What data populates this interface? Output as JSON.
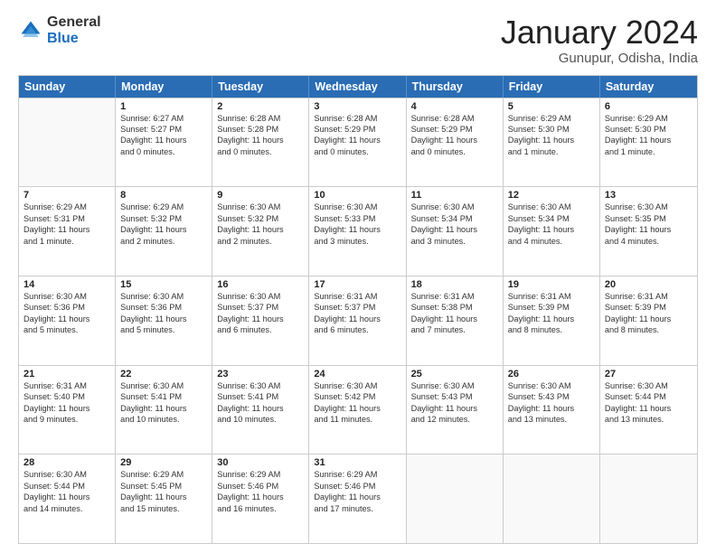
{
  "logo": {
    "general": "General",
    "blue": "Blue"
  },
  "title": "January 2024",
  "location": "Gunupur, Odisha, India",
  "header_days": [
    "Sunday",
    "Monday",
    "Tuesday",
    "Wednesday",
    "Thursday",
    "Friday",
    "Saturday"
  ],
  "weeks": [
    [
      {
        "day": "",
        "lines": []
      },
      {
        "day": "1",
        "lines": [
          "Sunrise: 6:27 AM",
          "Sunset: 5:27 PM",
          "Daylight: 11 hours",
          "and 0 minutes."
        ]
      },
      {
        "day": "2",
        "lines": [
          "Sunrise: 6:28 AM",
          "Sunset: 5:28 PM",
          "Daylight: 11 hours",
          "and 0 minutes."
        ]
      },
      {
        "day": "3",
        "lines": [
          "Sunrise: 6:28 AM",
          "Sunset: 5:29 PM",
          "Daylight: 11 hours",
          "and 0 minutes."
        ]
      },
      {
        "day": "4",
        "lines": [
          "Sunrise: 6:28 AM",
          "Sunset: 5:29 PM",
          "Daylight: 11 hours",
          "and 0 minutes."
        ]
      },
      {
        "day": "5",
        "lines": [
          "Sunrise: 6:29 AM",
          "Sunset: 5:30 PM",
          "Daylight: 11 hours",
          "and 1 minute."
        ]
      },
      {
        "day": "6",
        "lines": [
          "Sunrise: 6:29 AM",
          "Sunset: 5:30 PM",
          "Daylight: 11 hours",
          "and 1 minute."
        ]
      }
    ],
    [
      {
        "day": "7",
        "lines": [
          "Sunrise: 6:29 AM",
          "Sunset: 5:31 PM",
          "Daylight: 11 hours",
          "and 1 minute."
        ]
      },
      {
        "day": "8",
        "lines": [
          "Sunrise: 6:29 AM",
          "Sunset: 5:32 PM",
          "Daylight: 11 hours",
          "and 2 minutes."
        ]
      },
      {
        "day": "9",
        "lines": [
          "Sunrise: 6:30 AM",
          "Sunset: 5:32 PM",
          "Daylight: 11 hours",
          "and 2 minutes."
        ]
      },
      {
        "day": "10",
        "lines": [
          "Sunrise: 6:30 AM",
          "Sunset: 5:33 PM",
          "Daylight: 11 hours",
          "and 3 minutes."
        ]
      },
      {
        "day": "11",
        "lines": [
          "Sunrise: 6:30 AM",
          "Sunset: 5:34 PM",
          "Daylight: 11 hours",
          "and 3 minutes."
        ]
      },
      {
        "day": "12",
        "lines": [
          "Sunrise: 6:30 AM",
          "Sunset: 5:34 PM",
          "Daylight: 11 hours",
          "and 4 minutes."
        ]
      },
      {
        "day": "13",
        "lines": [
          "Sunrise: 6:30 AM",
          "Sunset: 5:35 PM",
          "Daylight: 11 hours",
          "and 4 minutes."
        ]
      }
    ],
    [
      {
        "day": "14",
        "lines": [
          "Sunrise: 6:30 AM",
          "Sunset: 5:36 PM",
          "Daylight: 11 hours",
          "and 5 minutes."
        ]
      },
      {
        "day": "15",
        "lines": [
          "Sunrise: 6:30 AM",
          "Sunset: 5:36 PM",
          "Daylight: 11 hours",
          "and 5 minutes."
        ]
      },
      {
        "day": "16",
        "lines": [
          "Sunrise: 6:30 AM",
          "Sunset: 5:37 PM",
          "Daylight: 11 hours",
          "and 6 minutes."
        ]
      },
      {
        "day": "17",
        "lines": [
          "Sunrise: 6:31 AM",
          "Sunset: 5:37 PM",
          "Daylight: 11 hours",
          "and 6 minutes."
        ]
      },
      {
        "day": "18",
        "lines": [
          "Sunrise: 6:31 AM",
          "Sunset: 5:38 PM",
          "Daylight: 11 hours",
          "and 7 minutes."
        ]
      },
      {
        "day": "19",
        "lines": [
          "Sunrise: 6:31 AM",
          "Sunset: 5:39 PM",
          "Daylight: 11 hours",
          "and 8 minutes."
        ]
      },
      {
        "day": "20",
        "lines": [
          "Sunrise: 6:31 AM",
          "Sunset: 5:39 PM",
          "Daylight: 11 hours",
          "and 8 minutes."
        ]
      }
    ],
    [
      {
        "day": "21",
        "lines": [
          "Sunrise: 6:31 AM",
          "Sunset: 5:40 PM",
          "Daylight: 11 hours",
          "and 9 minutes."
        ]
      },
      {
        "day": "22",
        "lines": [
          "Sunrise: 6:30 AM",
          "Sunset: 5:41 PM",
          "Daylight: 11 hours",
          "and 10 minutes."
        ]
      },
      {
        "day": "23",
        "lines": [
          "Sunrise: 6:30 AM",
          "Sunset: 5:41 PM",
          "Daylight: 11 hours",
          "and 10 minutes."
        ]
      },
      {
        "day": "24",
        "lines": [
          "Sunrise: 6:30 AM",
          "Sunset: 5:42 PM",
          "Daylight: 11 hours",
          "and 11 minutes."
        ]
      },
      {
        "day": "25",
        "lines": [
          "Sunrise: 6:30 AM",
          "Sunset: 5:43 PM",
          "Daylight: 11 hours",
          "and 12 minutes."
        ]
      },
      {
        "day": "26",
        "lines": [
          "Sunrise: 6:30 AM",
          "Sunset: 5:43 PM",
          "Daylight: 11 hours",
          "and 13 minutes."
        ]
      },
      {
        "day": "27",
        "lines": [
          "Sunrise: 6:30 AM",
          "Sunset: 5:44 PM",
          "Daylight: 11 hours",
          "and 13 minutes."
        ]
      }
    ],
    [
      {
        "day": "28",
        "lines": [
          "Sunrise: 6:30 AM",
          "Sunset: 5:44 PM",
          "Daylight: 11 hours",
          "and 14 minutes."
        ]
      },
      {
        "day": "29",
        "lines": [
          "Sunrise: 6:29 AM",
          "Sunset: 5:45 PM",
          "Daylight: 11 hours",
          "and 15 minutes."
        ]
      },
      {
        "day": "30",
        "lines": [
          "Sunrise: 6:29 AM",
          "Sunset: 5:46 PM",
          "Daylight: 11 hours",
          "and 16 minutes."
        ]
      },
      {
        "day": "31",
        "lines": [
          "Sunrise: 6:29 AM",
          "Sunset: 5:46 PM",
          "Daylight: 11 hours",
          "and 17 minutes."
        ]
      },
      {
        "day": "",
        "lines": []
      },
      {
        "day": "",
        "lines": []
      },
      {
        "day": "",
        "lines": []
      }
    ]
  ]
}
